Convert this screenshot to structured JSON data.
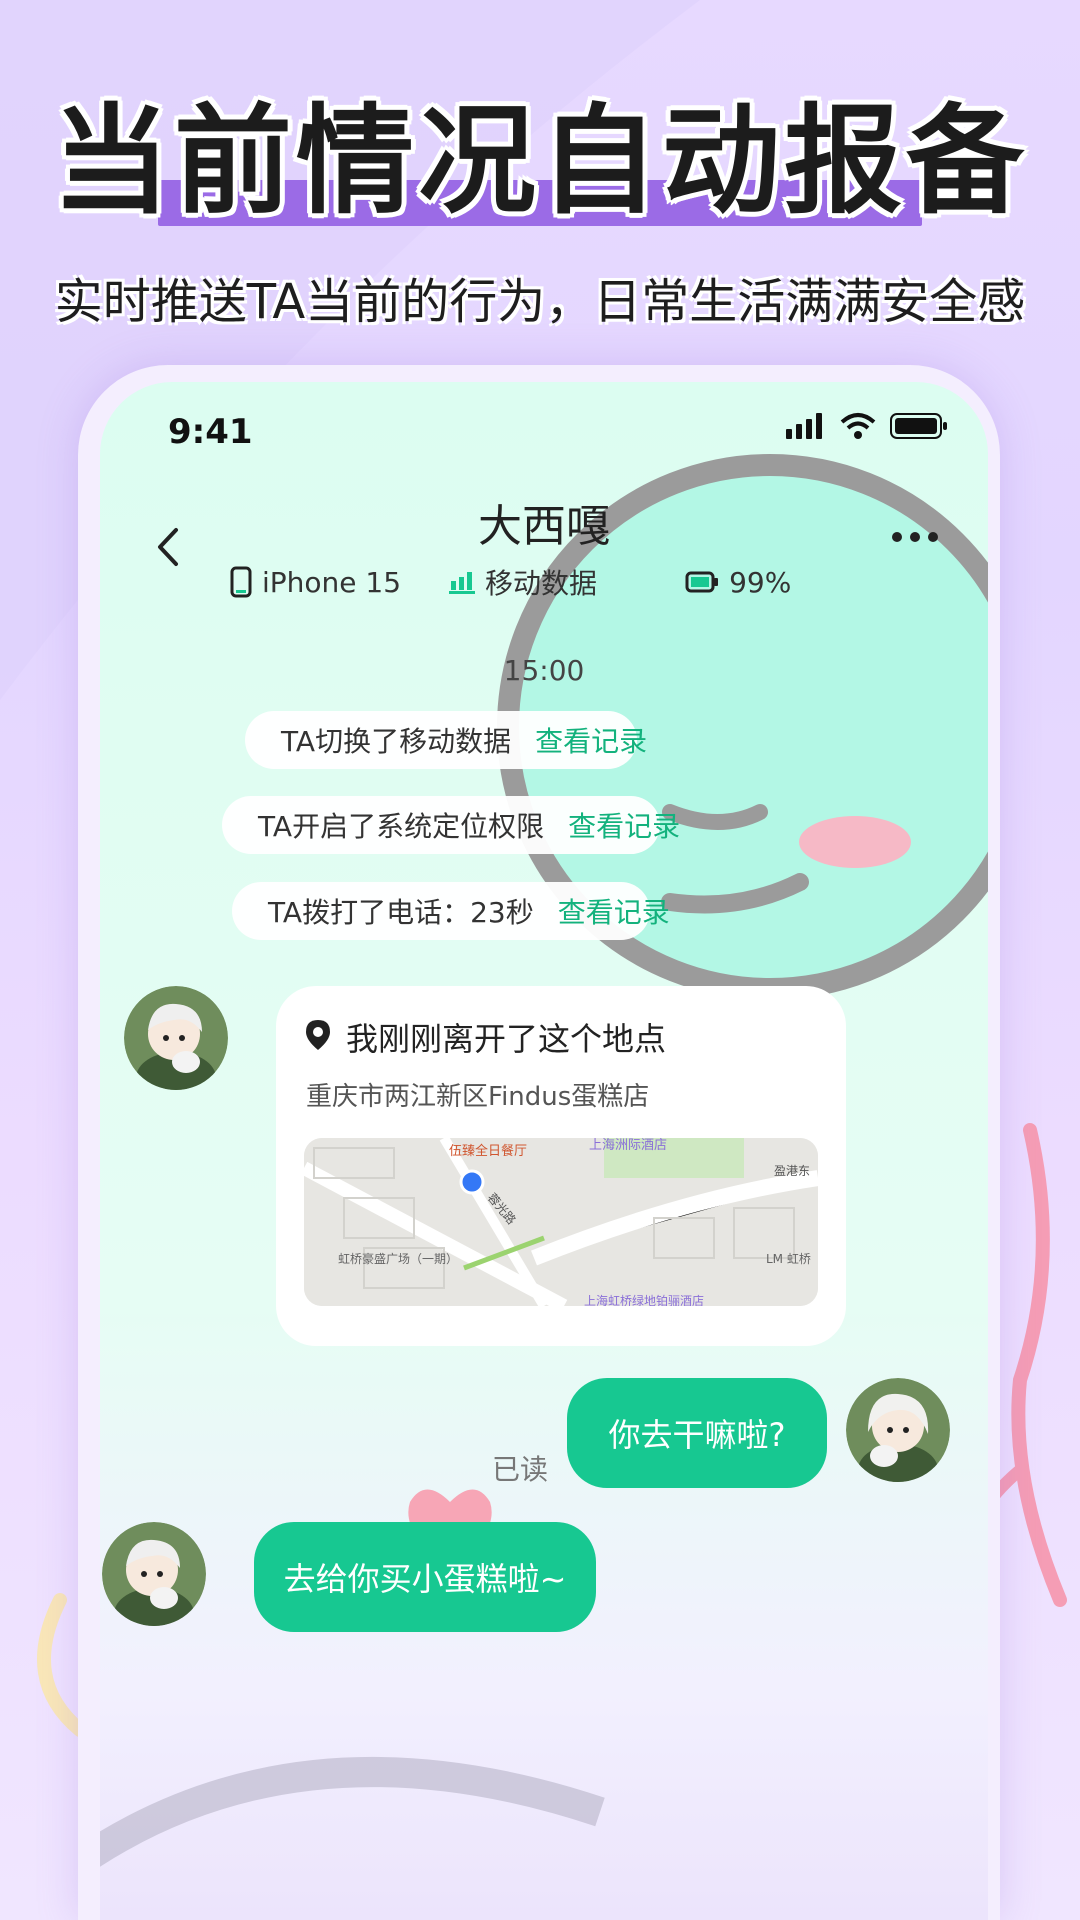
{
  "promo": {
    "headline": "当前情况自动报备",
    "subheadline": "实时推送TA当前的行为，日常生活满满安全感"
  },
  "status_bar": {
    "time": "9:41"
  },
  "chat_header": {
    "title": "大西嘎",
    "device": "iPhone 15",
    "network": "移动数据",
    "battery": "99%"
  },
  "timestamp": "15:00",
  "notices": [
    {
      "text": "TA切换了移动数据",
      "link": "查看记录",
      "icon": "signal-bars-icon"
    },
    {
      "text": "TA开启了系统定位权限",
      "link": "查看记录",
      "icon": "shield-check-icon"
    },
    {
      "text": "TA拨打了电话：23秒",
      "link": "查看记录",
      "icon": "phone-icon"
    }
  ],
  "location_card": {
    "title": "我刚刚离开了这个地点",
    "address": "重庆市两江新区Findus蛋糕店",
    "map_labels": {
      "restaurant": "伍臻全日餐厅",
      "road": "盈港东",
      "street": "蓉光路",
      "mall": "虹桥豪盛广场（一期）",
      "lm": "LM 虹桥",
      "hotel_top": "上海洲际酒店",
      "hotel_bottom": "上海虹桥绿地铂骊酒店"
    }
  },
  "messages": [
    {
      "from": "me",
      "text": "你去干嘛啦?",
      "status": "已读"
    },
    {
      "from": "other",
      "text": "去给你买小蛋糕啦~"
    }
  ],
  "colors": {
    "accent": "#17c891",
    "link": "#13b27d",
    "headline_bar": "#9b6be6"
  }
}
